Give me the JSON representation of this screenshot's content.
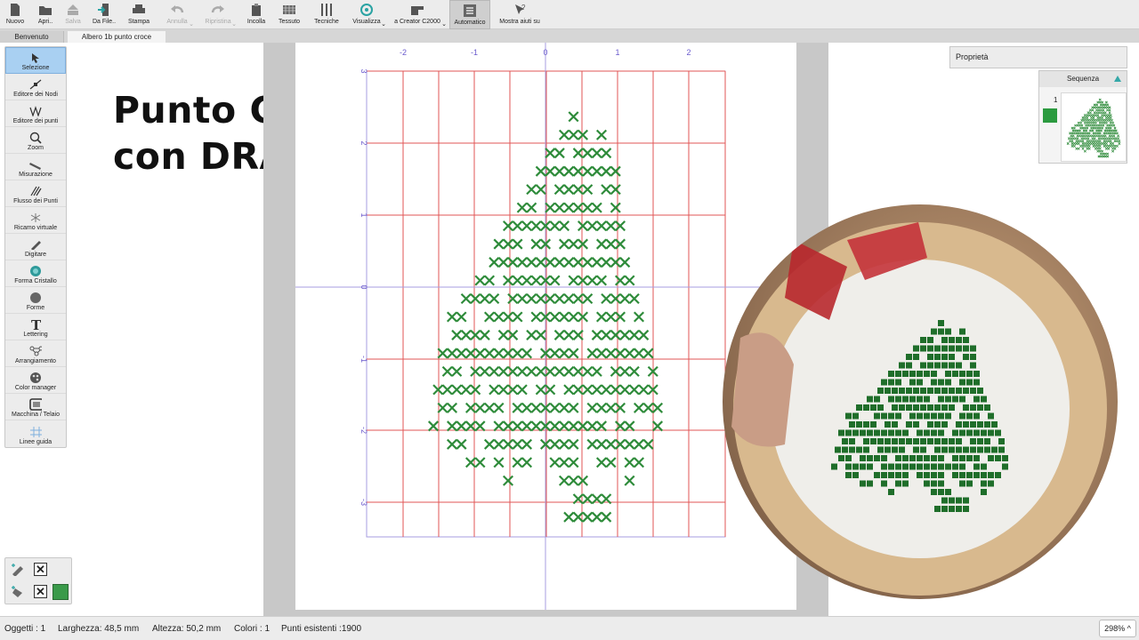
{
  "toolbar": {
    "buttons": [
      {
        "label": "Nuovo",
        "icon": "new-file-icon",
        "disabled": false
      },
      {
        "label": "Apri..",
        "icon": "open-folder-icon",
        "disabled": false
      },
      {
        "label": "Salva",
        "icon": "save-icon",
        "disabled": true
      },
      {
        "label": "Da File..",
        "icon": "import-file-icon",
        "disabled": false
      },
      {
        "label": "Stampa",
        "icon": "printer-icon",
        "disabled": false
      },
      {
        "label": "Annulla",
        "icon": "undo-icon",
        "disabled": true
      },
      {
        "label": "Ripristina",
        "icon": "redo-icon",
        "disabled": true
      },
      {
        "label": "Incolla",
        "icon": "paste-icon",
        "disabled": false
      },
      {
        "label": "Tessuto",
        "icon": "fabric-icon",
        "disabled": false
      },
      {
        "label": "Tecniche",
        "icon": "techniques-icon",
        "disabled": false
      },
      {
        "label": "Visualizza",
        "icon": "view-icon",
        "disabled": false
      },
      {
        "label": "a Creator C2000",
        "icon": "sewing-machine-icon",
        "disabled": false
      },
      {
        "label": "Automatico",
        "icon": "automatic-icon",
        "disabled": false
      },
      {
        "label": "Mostra aiuti su",
        "icon": "help-pointer-icon",
        "disabled": false
      }
    ]
  },
  "tabs": [
    "Benvenuto",
    "Albero 1b punto croce"
  ],
  "tools": [
    {
      "label": "Selezione",
      "icon": "select-arrow-icon"
    },
    {
      "label": "Editore dei Nodi",
      "icon": "node-editor-icon"
    },
    {
      "label": "Editore dei punti",
      "icon": "stitch-editor-icon"
    },
    {
      "label": "Zoom",
      "icon": "zoom-icon"
    },
    {
      "label": "Misurazione",
      "icon": "ruler-icon"
    },
    {
      "label": "Flusso dei Punti",
      "icon": "stitch-flow-icon"
    },
    {
      "label": "Ricamo virtuale",
      "icon": "virtual-embroidery-icon"
    },
    {
      "label": "Digitare",
      "icon": "digitize-icon"
    },
    {
      "label": "Forma Cristallo",
      "icon": "crystal-shape-icon"
    },
    {
      "label": "Forme",
      "icon": "shapes-icon"
    },
    {
      "label": "Lettering",
      "icon": "lettering-icon"
    },
    {
      "label": "Arrangiamento",
      "icon": "arrangement-icon"
    },
    {
      "label": "Color manager",
      "icon": "color-manager-icon"
    },
    {
      "label": "Macchina / Telaio",
      "icon": "hoop-icon"
    },
    {
      "label": "Linee guida",
      "icon": "guidelines-icon"
    }
  ],
  "title_overlay": "Punto Croce\ncon DRAWings",
  "ruler": {
    "x_ticks": [
      "-2",
      "-1",
      "0",
      "1",
      "2"
    ],
    "y_ticks": [
      "3",
      "2",
      "1",
      "0",
      "-1",
      "-2",
      "-3"
    ]
  },
  "right_panel": {
    "properties_label": "Proprietà",
    "sequence_label": "Sequenza",
    "sequence_number": "1",
    "thread_color": "#2b9a3f"
  },
  "status": {
    "objects": "Oggetti : 1",
    "width": "Larghezza: 48,5 mm",
    "height": "Altezza: 50,2 mm",
    "colors": "Colori : 1",
    "stitches": "Punti esistenti :1900",
    "zoom": "298%"
  },
  "colors": {
    "stitch_green": "#2e8b3a",
    "grid_red": "#e05555",
    "axis_purple": "#a79ee0"
  }
}
